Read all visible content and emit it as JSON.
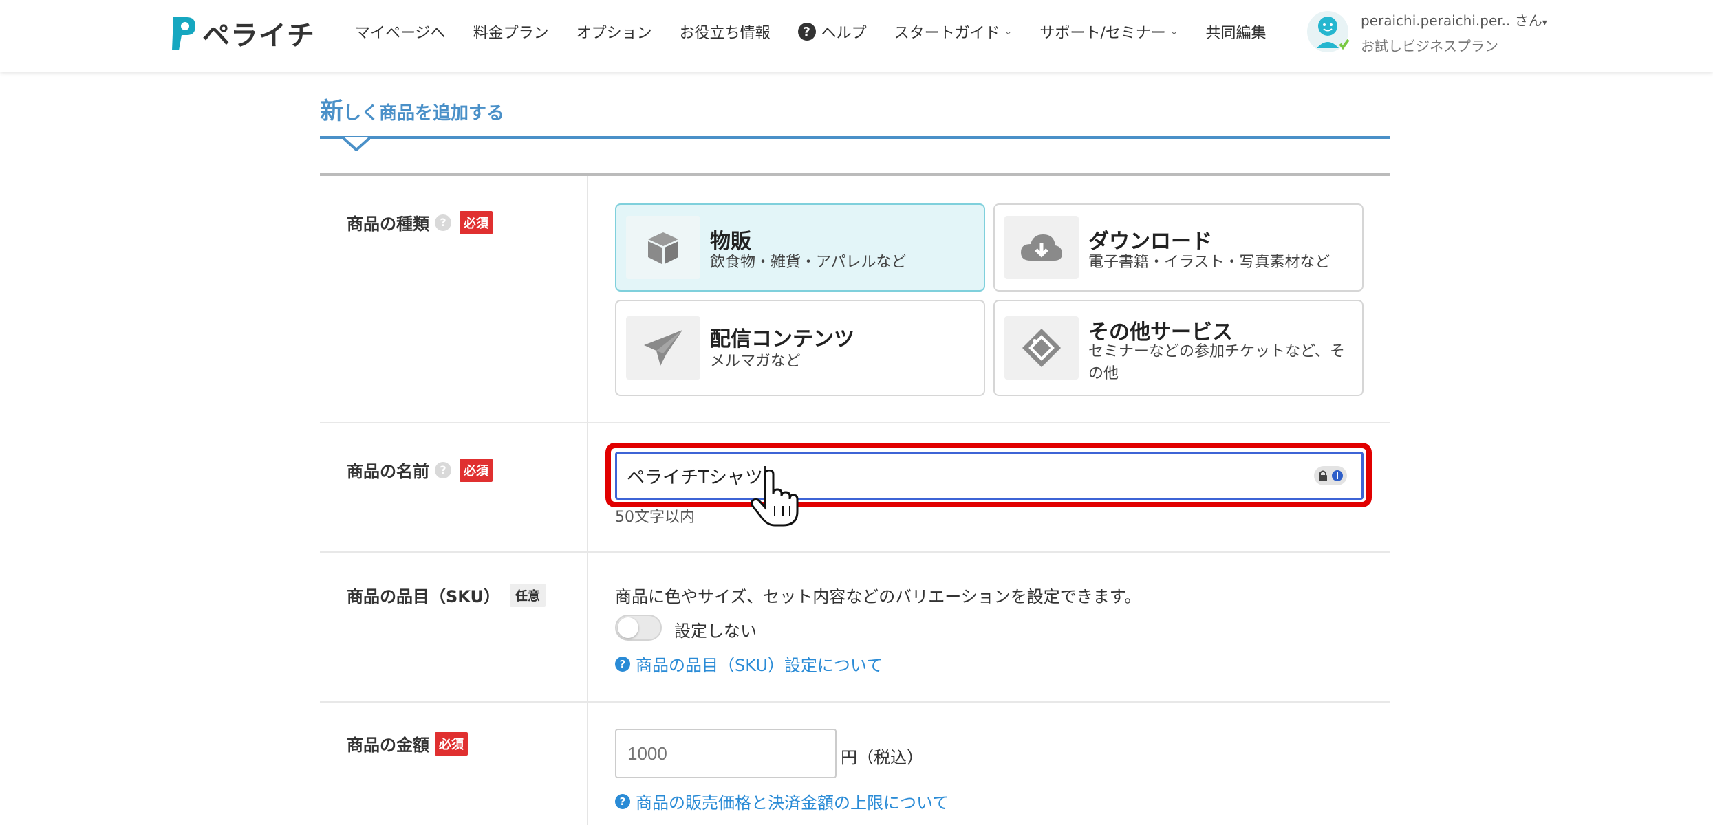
{
  "header": {
    "logo_text": "ペライチ",
    "nav": {
      "mypage": "マイページへ",
      "pricing": "料金プラン",
      "options": "オプション",
      "info": "お役立ち情報",
      "help": "ヘルプ",
      "startguide": "スタートガイド",
      "support": "サポート/セミナー",
      "coedit": "共同編集"
    },
    "user": {
      "name": "peraichi.peraichi.per.. さん",
      "plan": "お試しビジネスプラン"
    }
  },
  "page": {
    "title_first": "新",
    "title_rest": "しく商品を追加する"
  },
  "badges": {
    "required": "必須",
    "optional": "任意"
  },
  "product_type": {
    "label": "商品の種類",
    "options": [
      {
        "title": "物販",
        "desc": "飲食物・雑貨・アパレルなど",
        "icon": "box-icon",
        "selected": true
      },
      {
        "title": "ダウンロード",
        "desc": "電子書籍・イラスト・写真素材など",
        "icon": "cloud-download-icon",
        "selected": false
      },
      {
        "title": "配信コンテンツ",
        "desc": "メルマガなど",
        "icon": "paper-plane-icon",
        "selected": false
      },
      {
        "title": "その他サービス",
        "desc": "セミナーなどの参加チケットなど、その他",
        "icon": "ticket-icon",
        "selected": false
      }
    ]
  },
  "product_name": {
    "label": "商品の名前",
    "value": "ペライチTシャツ",
    "helper": "50文字以内"
  },
  "sku": {
    "label": "商品の品目（SKU）",
    "description": "商品に色やサイズ、セット内容などのバリエーションを設定できます。",
    "toggle_label": "設定しない",
    "toggle_on": false,
    "help_link": "商品の品目（SKU）設定について"
  },
  "price": {
    "label": "商品の金額",
    "placeholder": "1000",
    "unit": "円（税込）",
    "help_link": "商品の販売価格と決済金額の上限について"
  },
  "colors": {
    "accent": "#4a90c8",
    "required_badge": "#e03030",
    "highlight": "#e10000",
    "selected_card": "#e3f5f8",
    "link": "#2a8bd6"
  }
}
